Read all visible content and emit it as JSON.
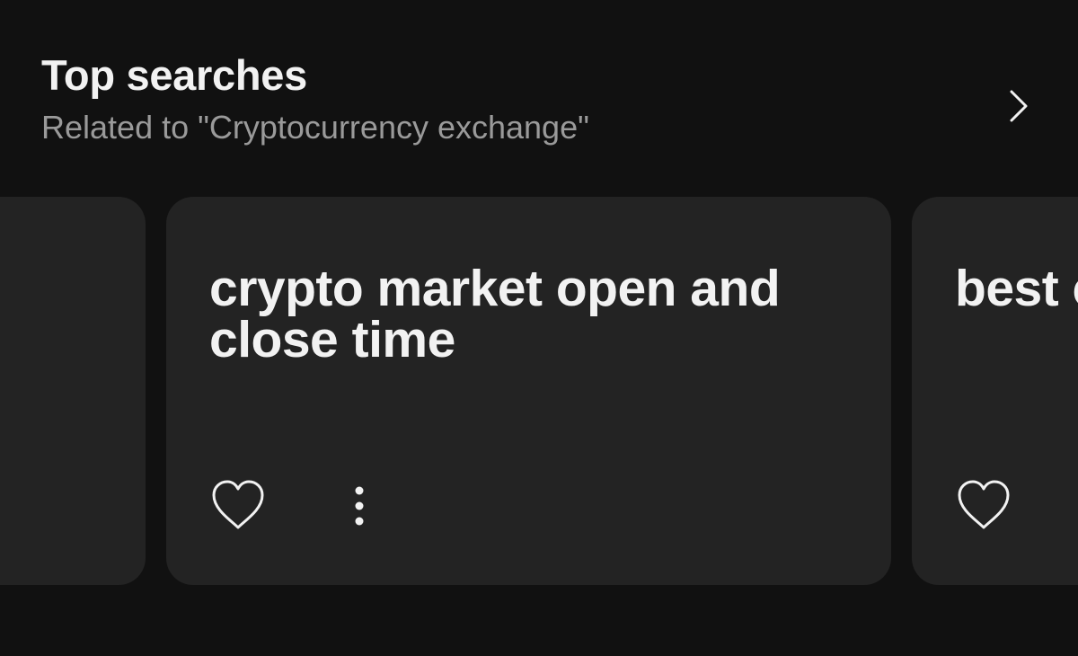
{
  "header": {
    "title": "Top searches",
    "subtitle": "Related to \"Cryptocurrency exchange\"",
    "chevron_icon": "chevron-right-icon"
  },
  "cards": [
    {
      "text": ""
    },
    {
      "text": "crypto market open and close time"
    },
    {
      "text": "best crypt"
    }
  ],
  "icons": {
    "favorite": "heart-outline-icon",
    "more": "vertical-ellipsis-icon"
  },
  "colors": {
    "background": "#111111",
    "card": "#232323",
    "text": "#f2f2f2",
    "subtext": "#9a9a9a"
  }
}
